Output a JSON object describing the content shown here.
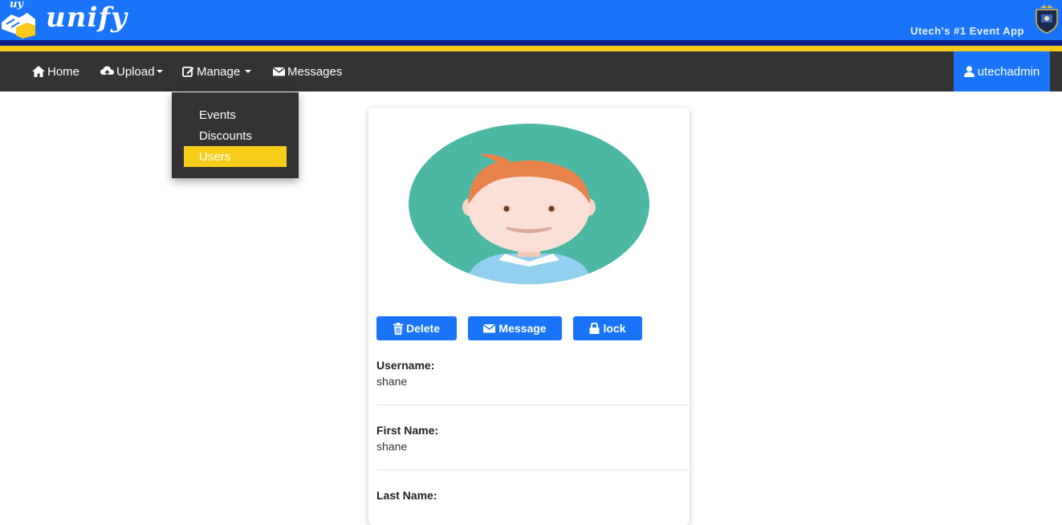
{
  "brand": {
    "logo_small": "uy",
    "logo_word": "unify",
    "tagline": "Utech's #1 Event App"
  },
  "nav": {
    "home": "Home",
    "upload": "Upload",
    "manage": "Manage",
    "messages": "Messages",
    "user": "utechadmin"
  },
  "dropdown": {
    "items": [
      "Events",
      "Discounts",
      "Users"
    ],
    "active": "Users"
  },
  "profile": {
    "actions": {
      "delete": "Delete",
      "message": "Message",
      "lock": "lock"
    },
    "fields": [
      {
        "label": "Username:",
        "value": "shane"
      },
      {
        "label": "First Name:",
        "value": "shane"
      },
      {
        "label": "Last Name:",
        "value": ""
      }
    ]
  },
  "colors": {
    "primary": "#1a74fa",
    "navbar": "#333333",
    "accent_gold": "#f7c91b",
    "navy": "#0a1f8c"
  }
}
